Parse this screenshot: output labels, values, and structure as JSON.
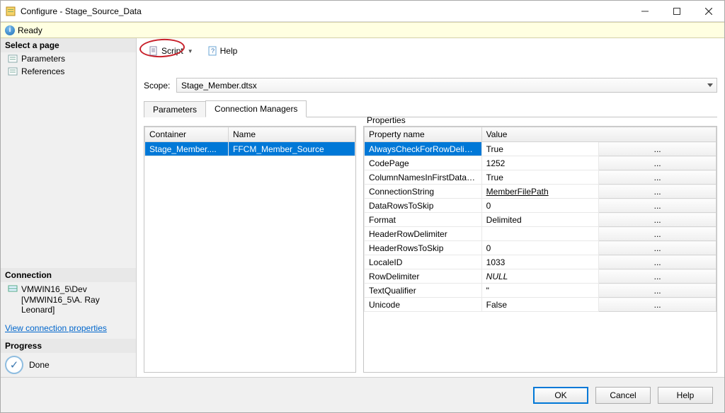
{
  "window": {
    "title": "Configure - Stage_Source_Data"
  },
  "status": {
    "text": "Ready"
  },
  "left": {
    "select_page_header": "Select a page",
    "nav": {
      "parameters": "Parameters",
      "references": "References"
    },
    "connection_header": "Connection",
    "connection_server": "VMWIN16_5\\Dev",
    "connection_user": "[VMWIN16_5\\A. Ray Leonard]",
    "view_connection_link": "View connection properties",
    "progress_header": "Progress",
    "progress_status": "Done"
  },
  "toolbar": {
    "script_label": "Script",
    "help_label": "Help"
  },
  "scope": {
    "label": "Scope:",
    "value": "Stage_Member.dtsx"
  },
  "tabs": {
    "parameters": "Parameters",
    "connection_managers": "Connection Managers"
  },
  "cm_table": {
    "headers": {
      "container": "Container",
      "name": "Name"
    },
    "rows": [
      {
        "container": "Stage_Member....",
        "name": "FFCM_Member_Source"
      }
    ]
  },
  "properties": {
    "title": "Properties",
    "headers": {
      "name": "Property name",
      "value": "Value"
    },
    "rows": [
      {
        "name": "AlwaysCheckForRowDelimiters",
        "value": "True",
        "selected": true
      },
      {
        "name": "CodePage",
        "value": "1252"
      },
      {
        "name": "ColumnNamesInFirstDataRow",
        "value": "True"
      },
      {
        "name": "ConnectionString",
        "value": "MemberFilePath",
        "underline": true
      },
      {
        "name": "DataRowsToSkip",
        "value": "0"
      },
      {
        "name": "Format",
        "value": "Delimited"
      },
      {
        "name": "HeaderRowDelimiter",
        "value": ""
      },
      {
        "name": "HeaderRowsToSkip",
        "value": "0"
      },
      {
        "name": "LocaleID",
        "value": "1033"
      },
      {
        "name": "RowDelimiter",
        "value": "NULL",
        "italic": true
      },
      {
        "name": "TextQualifier",
        "value": "\""
      },
      {
        "name": "Unicode",
        "value": "False"
      }
    ]
  },
  "buttons": {
    "ok": "OK",
    "cancel": "Cancel",
    "help": "Help"
  }
}
